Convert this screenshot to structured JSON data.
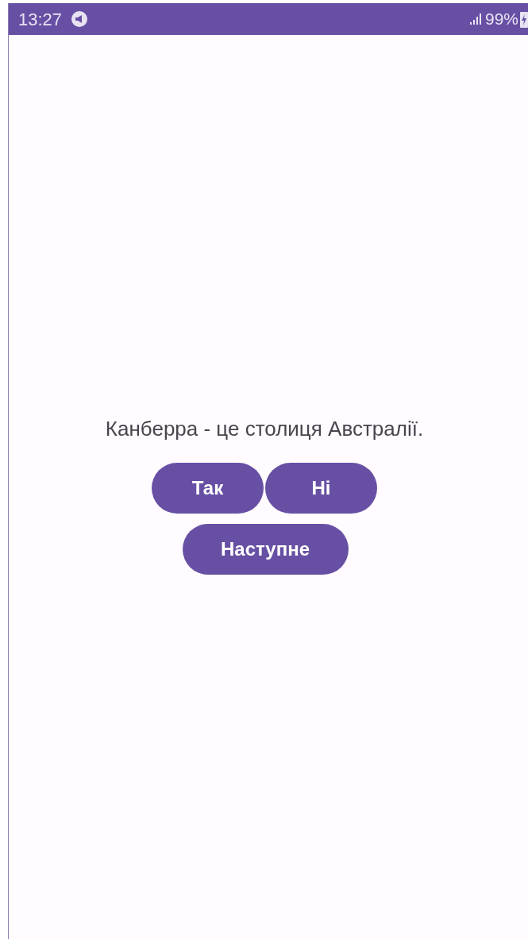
{
  "status_bar": {
    "time": "13:27",
    "battery": "99%"
  },
  "question": "Канберра - це столиця Австралії.",
  "answer_buttons": [
    "Так",
    "Ні"
  ],
  "next_button": "Наступне"
}
